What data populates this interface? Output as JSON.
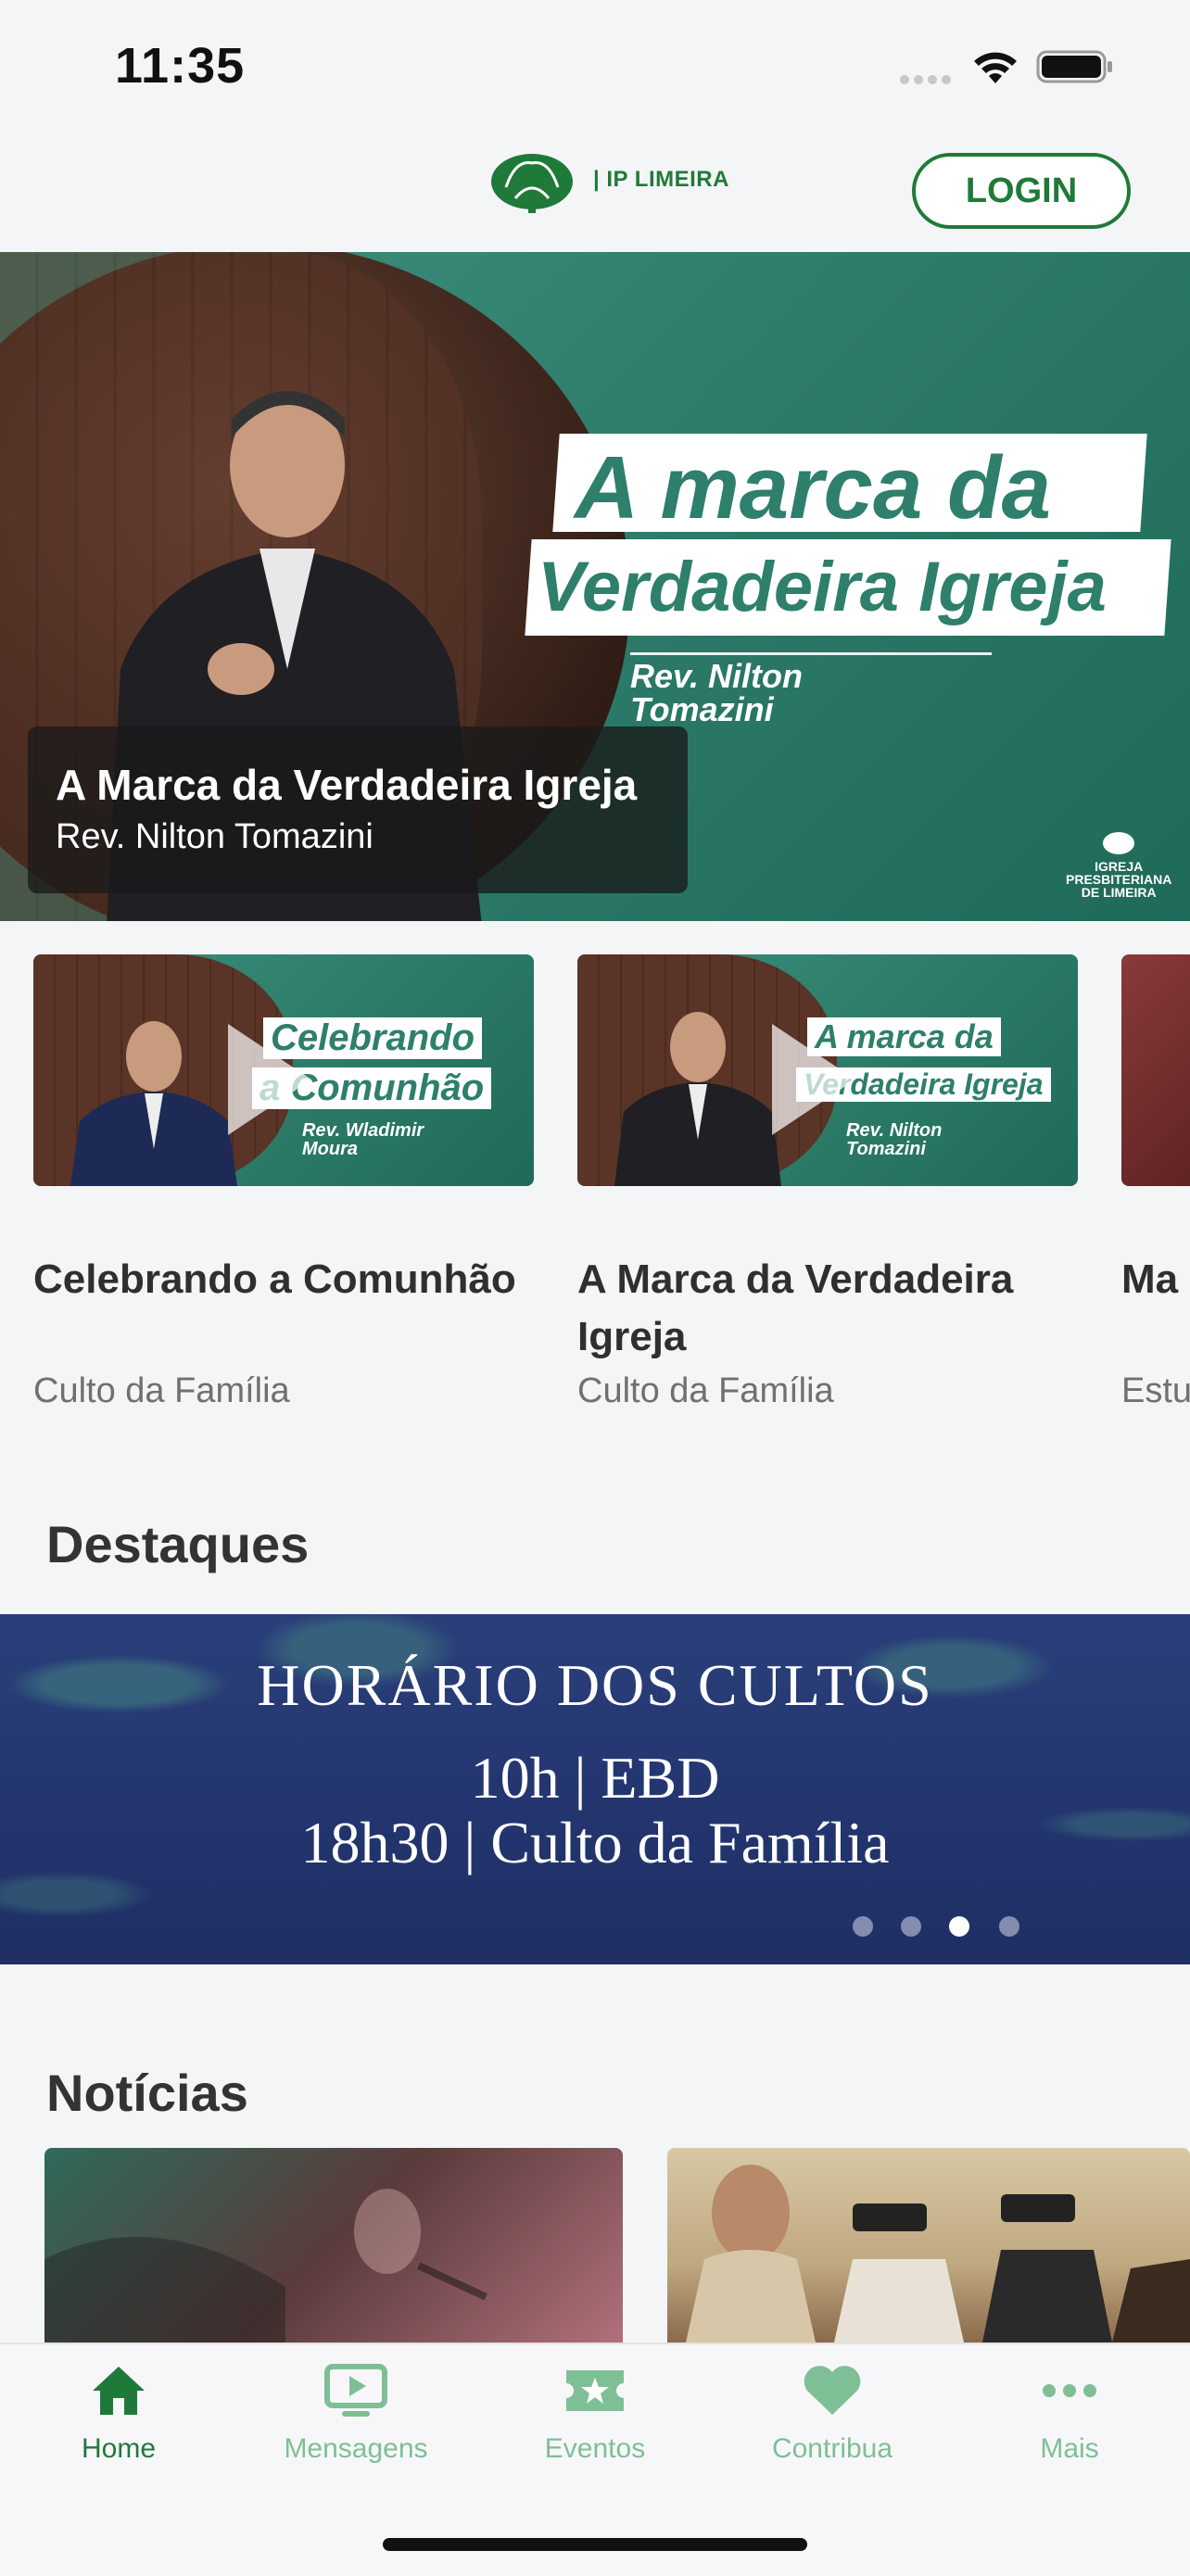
{
  "status_bar": {
    "time": "11:35"
  },
  "header": {
    "logo_text": "| IP LIMEIRA",
    "login_label": "LOGIN"
  },
  "hero": {
    "graphic_title_line1": "A marca da",
    "graphic_title_line2": "Verdadeira Igreja",
    "graphic_speaker": "Rev. Nilton\nTomazini",
    "graphic_church": "IGREJA\nPRESBITERIANA\nDE LIMEIRA",
    "caption_title": "A Marca da Verdadeira Igreja",
    "caption_subtitle": "Rev. Nilton Tomazini"
  },
  "videos": [
    {
      "thumb_line1": "Celebrando",
      "thumb_line2": "a Comunhão",
      "thumb_speaker": "Rev. Wladimir\nMoura",
      "title": "Celebrando a Comunhão",
      "subtitle": "Culto da Família"
    },
    {
      "thumb_line1": "A marca da",
      "thumb_line2": "Verdadeira Igreja",
      "thumb_speaker": "Rev. Nilton\nTomazini",
      "title": "A Marca da Verdadeira Igreja",
      "subtitle": "Culto da Família"
    },
    {
      "title": "Ma",
      "subtitle": "Estu"
    }
  ],
  "destaques": {
    "title": "Destaques",
    "banner_title": "HORÁRIO DOS CULTOS",
    "banner_line1": "10h | EBD",
    "banner_line2": "18h30 | Culto da Família",
    "active_slide": 3,
    "slide_count": 4
  },
  "noticias": {
    "title": "Notícias"
  },
  "tabbar": {
    "items": [
      {
        "label": "Home",
        "icon": "home-icon",
        "active": true
      },
      {
        "label": "Mensagens",
        "icon": "tv-play-icon",
        "active": false
      },
      {
        "label": "Eventos",
        "icon": "ticket-star-icon",
        "active": false
      },
      {
        "label": "Contribua",
        "icon": "heart-icon",
        "active": false
      },
      {
        "label": "Mais",
        "icon": "more-dots-icon",
        "active": false
      }
    ]
  },
  "colors": {
    "brand_green": "#1f7a3a",
    "tab_inactive": "#7fbf96",
    "hero_teal": "#2e7f6b",
    "banner_navy": "#243670"
  }
}
